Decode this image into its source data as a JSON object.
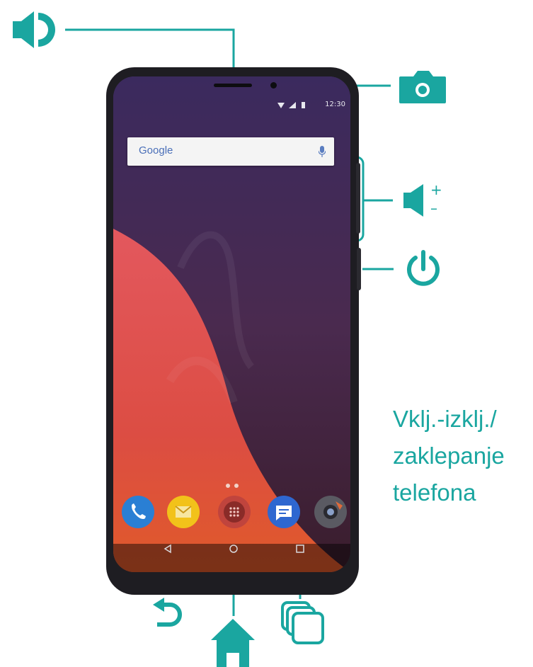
{
  "accent_color": "#1aa6a0",
  "callouts": {
    "speaker": {
      "icon": "speaker-icon"
    },
    "camera": {
      "icon": "camera-icon"
    },
    "volume": {
      "icon": "volume-icon",
      "plus": "+",
      "minus": "–"
    },
    "power": {
      "icon": "power-icon",
      "label_lines": [
        "Vklj.-izklj./",
        "zaklepanje",
        "telefona"
      ]
    },
    "back": {
      "icon": "back-arrow-icon"
    },
    "home": {
      "icon": "home-icon"
    },
    "recents": {
      "icon": "recent-apps-icon"
    }
  },
  "phone": {
    "status_bar": {
      "time": "12:30"
    },
    "search_widget": {
      "label": "Google"
    },
    "dock_apps": [
      "phone-app-icon",
      "email-app-icon",
      "app-drawer-icon",
      "messages-app-icon",
      "camera-app-icon"
    ],
    "nav_buttons": [
      "back-nav-icon",
      "home-nav-icon",
      "recents-nav-icon"
    ]
  }
}
